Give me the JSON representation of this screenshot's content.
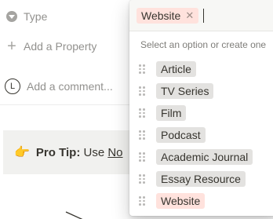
{
  "properties": {
    "type_label": "Type",
    "add_property_label": "Add a Property",
    "comment_placeholder": "Add a comment...",
    "avatar_initial": "L"
  },
  "callout": {
    "emoji": "👉",
    "bold": "Pro Tip:",
    "text": "Use",
    "link": "No"
  },
  "popup": {
    "selected_tag": {
      "label": "Website",
      "color": "#ffe2dd"
    },
    "hint": "Select an option or create one",
    "options": [
      {
        "label": "Article",
        "color": "#e3e2e0"
      },
      {
        "label": "TV Series",
        "color": "#e3e2e0"
      },
      {
        "label": "Film",
        "color": "#e3e2e0"
      },
      {
        "label": "Podcast",
        "color": "#e3e2e0"
      },
      {
        "label": "Academic Journal",
        "color": "#e3e2e0"
      },
      {
        "label": "Essay Resource",
        "color": "#e3e2e0"
      },
      {
        "label": "Website",
        "color": "#ffe2dd"
      }
    ]
  },
  "icons": {
    "type": "circle-caret-down-icon",
    "add": "plus-icon",
    "remove": "close-icon",
    "handle": "drag-handle-icon"
  }
}
